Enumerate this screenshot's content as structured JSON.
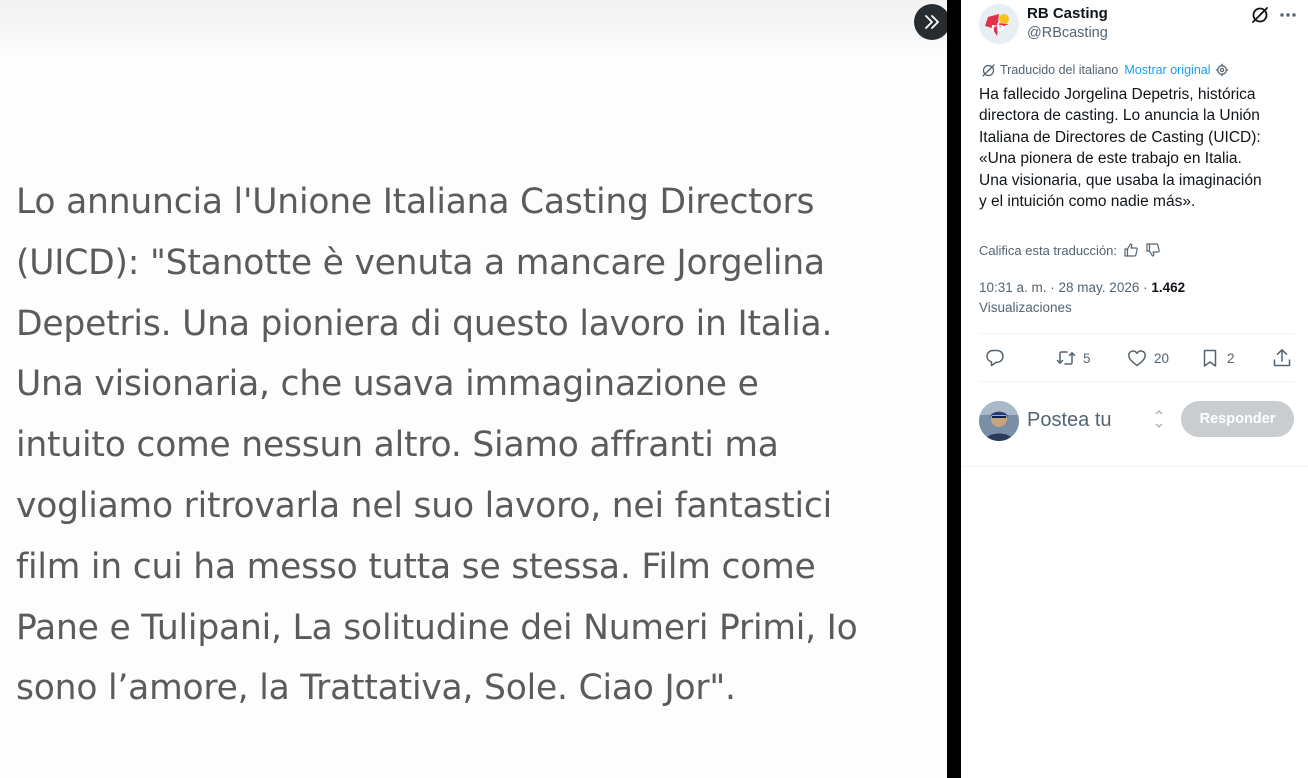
{
  "image_viewer": {
    "photo_text_lines": [
      "Lo annuncia l'Unione Italiana Casting Directors",
      "(UICD): \"Stanotte è venuta a mancare Jorgelina",
      "Depetris. Una pioniera di questo lavoro in Italia.",
      "Una visionaria, che usava immaginazione e",
      "intuito come nessun altro. Siamo affranti ma",
      "vogliamo ritrovarla nel suo lavoro, nei fantastici",
      "film in cui ha messo tutta se stessa. Film come",
      "Pane e Tulipani, La solitudine dei Numeri Primi, Io",
      "sono l’amore, la Trattativa, Sole. Ciao Jor\"."
    ],
    "expand_icon": "double-chevron-right-icon"
  },
  "tweet": {
    "author_name": "RB Casting",
    "author_handle": "@RBcasting",
    "translated_label": "Traducido del italiano",
    "show_original_label": "Mostrar original",
    "text_lines": [
      "Ha fallecido Jorgelina Depetris, histórica",
      "directora de casting. Lo anuncia la Unión",
      "Italiana de Directores de Casting (UICD):",
      "«Una pionera de este trabajo en Italia.",
      "Una visionaria, que usaba la imaginación",
      "y el intuición como nadie más»."
    ],
    "rate_translation_label": "Califica esta traducción:",
    "timestamp": "10:31 a. m. · 28 may. 2026 ·",
    "views_count": "1.462",
    "views_label": "Visualizaciones",
    "actions": {
      "reply_icon": "reply-icon",
      "retweet_count": "5",
      "like_count": "20",
      "bookmark_count": "2",
      "share_icon": "share-icon"
    },
    "reply_box": {
      "placeholder": "Postea tu",
      "button_label": "Responder"
    }
  },
  "colors": {
    "accent": "#1d9bf0",
    "text_secondary": "#536471",
    "photo_text": "#5b5b5b",
    "reply_button_disabled": "#c9cdd0"
  }
}
